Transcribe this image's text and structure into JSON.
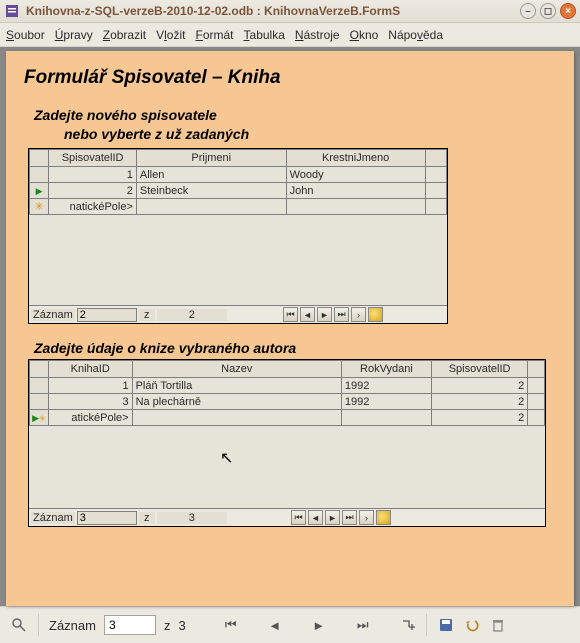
{
  "window": {
    "title": "Knihovna-z-SQL-verzeB-2010-12-02.odb : KnihovnaVerzeB.FormS"
  },
  "menu": {
    "soubor": "Soubor",
    "upravy": "Úpravy",
    "zobrazit": "Zobrazit",
    "vlozit": "Vložit",
    "format": "Formát",
    "tabulka": "Tabulka",
    "nastroje": "Nástroje",
    "okno": "Okno",
    "napoveda": "Nápověda"
  },
  "form": {
    "title": "Formulář Spisovatel – Kniha",
    "subform1": {
      "heading1": "Zadejte nového spisovatele",
      "heading2": "nebo vyberte z už zadaných",
      "columns": {
        "id": "SpisovatelID",
        "prijmeni": "Prijmeni",
        "jmeno": "KrestniJmeno"
      },
      "rows": [
        {
          "id": "1",
          "prijmeni": "Allen",
          "jmeno": "Woody"
        },
        {
          "id": "2",
          "prijmeni": "Steinbeck",
          "jmeno": "John"
        }
      ],
      "newrow_placeholder": "natickéPole>",
      "nav": {
        "label": "Záznam",
        "current": "2",
        "of": "z",
        "total": "2"
      }
    },
    "subform2": {
      "heading": "Zadejte údaje o knize vybraného autora",
      "columns": {
        "id": "KnihaID",
        "nazev": "Nazev",
        "rok": "RokVydani",
        "spis": "SpisovatelID"
      },
      "rows": [
        {
          "id": "1",
          "nazev": "Pláň Tortilla",
          "rok": "1992",
          "spis": "2"
        },
        {
          "id": "3",
          "nazev": "Na plechárně",
          "rok": "1992",
          "spis": "2"
        }
      ],
      "newrow_placeholder": "atickéPole>",
      "newrow_spis": "2",
      "nav": {
        "label": "Záznam",
        "current": "3",
        "of": "z",
        "total": "3"
      }
    }
  },
  "bottom": {
    "label": "Záznam",
    "current": "3",
    "of": "z",
    "total": "3"
  }
}
